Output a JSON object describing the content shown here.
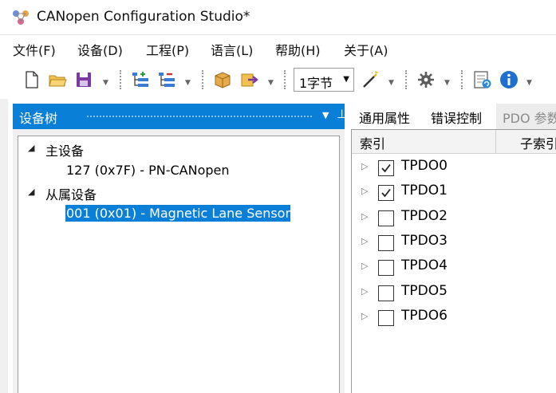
{
  "window": {
    "title": "CANopen Configuration Studio*"
  },
  "menu": {
    "items": [
      "文件(F)",
      "设备(D)",
      "工程(P)",
      "语言(L)",
      "帮助(H)",
      "关于(A)"
    ]
  },
  "toolbar": {
    "icons": [
      "new-file-icon",
      "open-folder-icon",
      "save-icon",
      "add-node-icon",
      "remove-node-icon",
      "package-icon",
      "export-icon",
      "magic-wand-icon",
      "settings-icon",
      "update-icon",
      "info-icon"
    ],
    "byte_combo_value": "1字节"
  },
  "panel": {
    "title": "设备树"
  },
  "tree": {
    "master_label": "主设备",
    "master_node": "127 (0x7F)  -  PN-CANopen",
    "slave_label": "从属设备",
    "slave_node": "001 (0x01)  -  Magnetic Lane Sensor"
  },
  "tabs": [
    "通用属性",
    "错误控制",
    "PDO 参数"
  ],
  "grid": {
    "col_index": "索引",
    "col_subindex": "子索引",
    "rows": [
      {
        "label": "TPDO0",
        "checked": true
      },
      {
        "label": "TPDO1",
        "checked": true
      },
      {
        "label": "TPDO2",
        "checked": false
      },
      {
        "label": "TPDO3",
        "checked": false
      },
      {
        "label": "TPDO4",
        "checked": false
      },
      {
        "label": "TPDO5",
        "checked": false
      },
      {
        "label": "TPDO6",
        "checked": false
      }
    ]
  },
  "colors": {
    "accent": "#0a7fd7",
    "selection": "#0a7fd7"
  }
}
